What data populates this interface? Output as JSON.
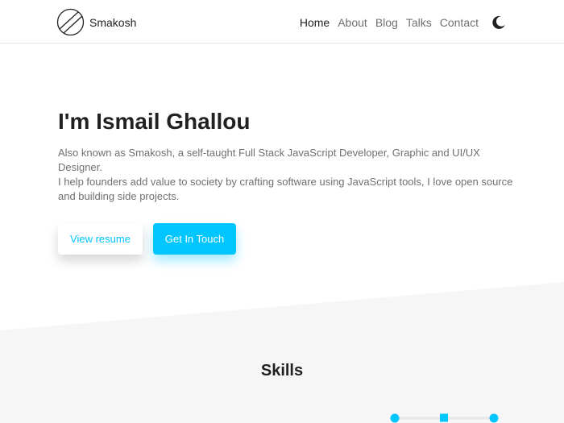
{
  "header": {
    "brand_name": "Smakosh",
    "nav": [
      {
        "label": "Home",
        "active": true
      },
      {
        "label": "About",
        "active": false
      },
      {
        "label": "Blog",
        "active": false
      },
      {
        "label": "Talks",
        "active": false
      },
      {
        "label": "Contact",
        "active": false
      }
    ],
    "theme_toggle_icon": "moon-icon"
  },
  "hero": {
    "title": "I'm Ismail Ghallou",
    "line1": "Also known as Smakosh, a self-taught Full Stack JavaScript Developer, Graphic and UI/UX Designer.",
    "line2": "I help founders add value to society by crafting software using JavaScript tools, I love open source and building side projects.",
    "resume_label": "View resume",
    "contact_label": "Get In Touch"
  },
  "skills": {
    "title": "Skills"
  },
  "colors": {
    "accent": "#00c6ff",
    "text": "#212121",
    "muted": "#707070",
    "section_bg": "#f6f6f6"
  }
}
